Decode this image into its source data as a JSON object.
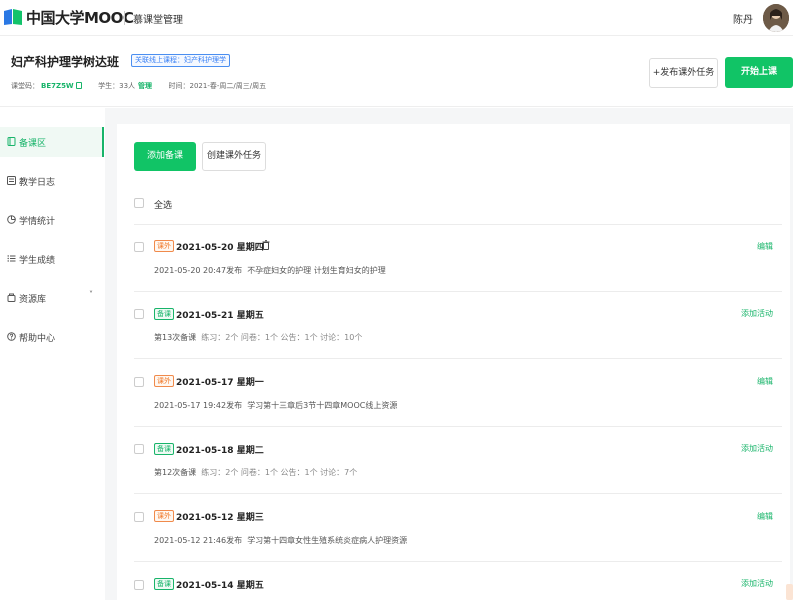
{
  "topbar": {
    "logo_text": "中国大学MOOC",
    "system_name": "慕课堂管理",
    "user_name": "陈丹"
  },
  "class_header": {
    "title": "妇产科护理学树达班",
    "linked_course_tag": "关联线上课程：妇产科护理学",
    "code_label": "课堂码：",
    "code_value": "BE7Z5W",
    "students_label": "学生：33人",
    "manage_label": "管理",
    "time_label": "时间：2021-春-周二/周三/周五",
    "publish_task_label": "+发布课外任务",
    "start_class_label": "开始上课"
  },
  "sidebar": {
    "items": [
      {
        "label": "备课区",
        "icon": "book-icon",
        "active": true
      },
      {
        "label": "教学日志",
        "icon": "log-icon"
      },
      {
        "label": "学情统计",
        "icon": "pie-chart-icon"
      },
      {
        "label": "学生成绩",
        "icon": "list-icon"
      },
      {
        "label": "资源库",
        "icon": "database-icon",
        "chevron": "˅"
      },
      {
        "label": "帮助中心",
        "icon": "help-icon"
      }
    ]
  },
  "toolbar": {
    "add_prep_label": "添加备课",
    "create_task_label": "创建课外任务",
    "select_all_label": "全选"
  },
  "rows": [
    {
      "tag": "课外",
      "tag_type": "out",
      "date": "2021-05-20 星期四",
      "trash": true,
      "sub_main": "2021-05-20 20:47发布",
      "sub_detail": "不孕症妇女的护理 计划生育妇女的护理",
      "action": "编辑"
    },
    {
      "tag": "备课",
      "tag_type": "prep",
      "date": "2021-05-21 星期五",
      "sub_main": "第13次备课",
      "sub_detail": "练习：2个 问卷：1个 公告：1个 讨论：10个",
      "action": "添加活动"
    },
    {
      "tag": "课外",
      "tag_type": "out",
      "date": "2021-05-17 星期一",
      "sub_main": "2021-05-17 19:42发布",
      "sub_detail": "学习第十三章后3节十四章MOOC线上资源",
      "action": "编辑"
    },
    {
      "tag": "备课",
      "tag_type": "prep",
      "date": "2021-05-18 星期二",
      "sub_main": "第12次备课",
      "sub_detail": "练习：2个 问卷：1个 公告：1个 讨论：7个",
      "action": "添加活动"
    },
    {
      "tag": "课外",
      "tag_type": "out",
      "date": "2021-05-12 星期三",
      "sub_main": "2021-05-12 21:46发布",
      "sub_detail": "学习第十四章女性生殖系统炎症病人护理资源",
      "action": "编辑"
    },
    {
      "tag": "备课",
      "tag_type": "prep",
      "date": "2021-05-14 星期五",
      "sub_main": "",
      "sub_detail": "",
      "action": "添加活动"
    }
  ],
  "colors": {
    "brand_green": "#11c466",
    "out_tag_orange": "#f07a2b",
    "link_blue": "#3b82f6"
  }
}
